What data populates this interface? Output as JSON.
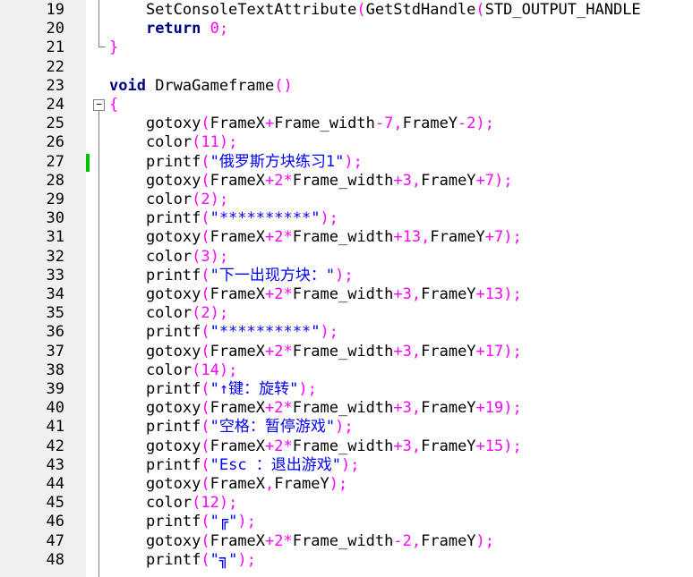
{
  "editor": {
    "colors": {
      "keyword": "#00008b",
      "number": "#ff00ff",
      "string": "#0000ff",
      "gutter": "#f0f0f0",
      "change_marker": "#00c000"
    },
    "lines": [
      {
        "n": "19",
        "tokens": [
          [
            "    SetConsoleTextAttribute",
            "t"
          ],
          [
            "(",
            "o"
          ],
          [
            "GetStdHandle",
            "t"
          ],
          [
            "(",
            "o"
          ],
          [
            "STD_OUTPUT_HANDLE",
            "t"
          ]
        ]
      },
      {
        "n": "20",
        "tokens": [
          [
            "    ",
            "t"
          ],
          [
            "return",
            "k"
          ],
          [
            " ",
            "t"
          ],
          [
            "0",
            "n"
          ],
          [
            ";",
            "o"
          ]
        ]
      },
      {
        "n": "21",
        "tokens": [
          [
            "}",
            "o"
          ]
        ]
      },
      {
        "n": "22",
        "tokens": []
      },
      {
        "n": "23",
        "tokens": [
          [
            "void",
            "k"
          ],
          [
            " DrwaGameframe",
            "t"
          ],
          [
            "()",
            "o"
          ]
        ]
      },
      {
        "n": "24",
        "tokens": [
          [
            "{",
            "o"
          ]
        ]
      },
      {
        "n": "25",
        "tokens": [
          [
            "    gotoxy",
            "t"
          ],
          [
            "(",
            "o"
          ],
          [
            "FrameX",
            "t"
          ],
          [
            "+",
            "o"
          ],
          [
            "Frame_width",
            "t"
          ],
          [
            "-",
            "o"
          ],
          [
            "7",
            "n"
          ],
          [
            ",",
            "o"
          ],
          [
            "FrameY",
            "t"
          ],
          [
            "-",
            "o"
          ],
          [
            "2",
            "n"
          ],
          [
            ");",
            "o"
          ]
        ]
      },
      {
        "n": "26",
        "tokens": [
          [
            "    color",
            "t"
          ],
          [
            "(",
            "o"
          ],
          [
            "11",
            "n"
          ],
          [
            ");",
            "o"
          ]
        ]
      },
      {
        "n": "27",
        "tokens": [
          [
            "    printf",
            "t"
          ],
          [
            "(",
            "o"
          ],
          [
            "\"俄罗斯方块练习1\"",
            "s"
          ],
          [
            ");",
            "o"
          ]
        ]
      },
      {
        "n": "28",
        "tokens": [
          [
            "    gotoxy",
            "t"
          ],
          [
            "(",
            "o"
          ],
          [
            "FrameX",
            "t"
          ],
          [
            "+",
            "o"
          ],
          [
            "2",
            "n"
          ],
          [
            "*",
            "o"
          ],
          [
            "Frame_width",
            "t"
          ],
          [
            "+",
            "o"
          ],
          [
            "3",
            "n"
          ],
          [
            ",",
            "o"
          ],
          [
            "FrameY",
            "t"
          ],
          [
            "+",
            "o"
          ],
          [
            "7",
            "n"
          ],
          [
            ");",
            "o"
          ]
        ]
      },
      {
        "n": "29",
        "tokens": [
          [
            "    color",
            "t"
          ],
          [
            "(",
            "o"
          ],
          [
            "2",
            "n"
          ],
          [
            ");",
            "o"
          ]
        ]
      },
      {
        "n": "30",
        "tokens": [
          [
            "    printf",
            "t"
          ],
          [
            "(",
            "o"
          ],
          [
            "\"**********\"",
            "s"
          ],
          [
            ");",
            "o"
          ]
        ]
      },
      {
        "n": "31",
        "tokens": [
          [
            "    gotoxy",
            "t"
          ],
          [
            "(",
            "o"
          ],
          [
            "FrameX",
            "t"
          ],
          [
            "+",
            "o"
          ],
          [
            "2",
            "n"
          ],
          [
            "*",
            "o"
          ],
          [
            "Frame_width",
            "t"
          ],
          [
            "+",
            "o"
          ],
          [
            "13",
            "n"
          ],
          [
            ",",
            "o"
          ],
          [
            "FrameY",
            "t"
          ],
          [
            "+",
            "o"
          ],
          [
            "7",
            "n"
          ],
          [
            ");",
            "o"
          ]
        ]
      },
      {
        "n": "32",
        "tokens": [
          [
            "    color",
            "t"
          ],
          [
            "(",
            "o"
          ],
          [
            "3",
            "n"
          ],
          [
            ");",
            "o"
          ]
        ]
      },
      {
        "n": "33",
        "tokens": [
          [
            "    printf",
            "t"
          ],
          [
            "(",
            "o"
          ],
          [
            "\"下一出现方块：\"",
            "s"
          ],
          [
            ");",
            "o"
          ]
        ]
      },
      {
        "n": "34",
        "tokens": [
          [
            "    gotoxy",
            "t"
          ],
          [
            "(",
            "o"
          ],
          [
            "FrameX",
            "t"
          ],
          [
            "+",
            "o"
          ],
          [
            "2",
            "n"
          ],
          [
            "*",
            "o"
          ],
          [
            "Frame_width",
            "t"
          ],
          [
            "+",
            "o"
          ],
          [
            "3",
            "n"
          ],
          [
            ",",
            "o"
          ],
          [
            "FrameY",
            "t"
          ],
          [
            "+",
            "o"
          ],
          [
            "13",
            "n"
          ],
          [
            ");",
            "o"
          ]
        ]
      },
      {
        "n": "35",
        "tokens": [
          [
            "    color",
            "t"
          ],
          [
            "(",
            "o"
          ],
          [
            "2",
            "n"
          ],
          [
            ");",
            "o"
          ]
        ]
      },
      {
        "n": "36",
        "tokens": [
          [
            "    printf",
            "t"
          ],
          [
            "(",
            "o"
          ],
          [
            "\"**********\"",
            "s"
          ],
          [
            ");",
            "o"
          ]
        ]
      },
      {
        "n": "37",
        "tokens": [
          [
            "    gotoxy",
            "t"
          ],
          [
            "(",
            "o"
          ],
          [
            "FrameX",
            "t"
          ],
          [
            "+",
            "o"
          ],
          [
            "2",
            "n"
          ],
          [
            "*",
            "o"
          ],
          [
            "Frame_width",
            "t"
          ],
          [
            "+",
            "o"
          ],
          [
            "3",
            "n"
          ],
          [
            ",",
            "o"
          ],
          [
            "FrameY",
            "t"
          ],
          [
            "+",
            "o"
          ],
          [
            "17",
            "n"
          ],
          [
            ");",
            "o"
          ]
        ]
      },
      {
        "n": "38",
        "tokens": [
          [
            "    color",
            "t"
          ],
          [
            "(",
            "o"
          ],
          [
            "14",
            "n"
          ],
          [
            ");",
            "o"
          ]
        ]
      },
      {
        "n": "39",
        "tokens": [
          [
            "    printf",
            "t"
          ],
          [
            "(",
            "o"
          ],
          [
            "\"↑键：旋转\"",
            "s"
          ],
          [
            ");",
            "o"
          ]
        ]
      },
      {
        "n": "40",
        "tokens": [
          [
            "    gotoxy",
            "t"
          ],
          [
            "(",
            "o"
          ],
          [
            "FrameX",
            "t"
          ],
          [
            "+",
            "o"
          ],
          [
            "2",
            "n"
          ],
          [
            "*",
            "o"
          ],
          [
            "Frame_width",
            "t"
          ],
          [
            "+",
            "o"
          ],
          [
            "3",
            "n"
          ],
          [
            ",",
            "o"
          ],
          [
            "FrameY",
            "t"
          ],
          [
            "+",
            "o"
          ],
          [
            "19",
            "n"
          ],
          [
            ");",
            "o"
          ]
        ]
      },
      {
        "n": "41",
        "tokens": [
          [
            "    printf",
            "t"
          ],
          [
            "(",
            "o"
          ],
          [
            "\"空格：暂停游戏\"",
            "s"
          ],
          [
            ");",
            "o"
          ]
        ]
      },
      {
        "n": "42",
        "tokens": [
          [
            "    gotoxy",
            "t"
          ],
          [
            "(",
            "o"
          ],
          [
            "FrameX",
            "t"
          ],
          [
            "+",
            "o"
          ],
          [
            "2",
            "n"
          ],
          [
            "*",
            "o"
          ],
          [
            "Frame_width",
            "t"
          ],
          [
            "+",
            "o"
          ],
          [
            "3",
            "n"
          ],
          [
            ",",
            "o"
          ],
          [
            "FrameY",
            "t"
          ],
          [
            "+",
            "o"
          ],
          [
            "15",
            "n"
          ],
          [
            ");",
            "o"
          ]
        ]
      },
      {
        "n": "43",
        "tokens": [
          [
            "    printf",
            "t"
          ],
          [
            "(",
            "o"
          ],
          [
            "\"Esc ：退出游戏\"",
            "s"
          ],
          [
            ");",
            "o"
          ]
        ]
      },
      {
        "n": "44",
        "tokens": [
          [
            "    gotoxy",
            "t"
          ],
          [
            "(",
            "o"
          ],
          [
            "FrameX",
            "t"
          ],
          [
            ",",
            "o"
          ],
          [
            "FrameY",
            "t"
          ],
          [
            ");",
            "o"
          ]
        ]
      },
      {
        "n": "45",
        "tokens": [
          [
            "    color",
            "t"
          ],
          [
            "(",
            "o"
          ],
          [
            "12",
            "n"
          ],
          [
            ");",
            "o"
          ]
        ]
      },
      {
        "n": "46",
        "tokens": [
          [
            "    printf",
            "t"
          ],
          [
            "(",
            "o"
          ],
          [
            "\"╔\"",
            "s"
          ],
          [
            ");",
            "o"
          ]
        ]
      },
      {
        "n": "47",
        "tokens": [
          [
            "    gotoxy",
            "t"
          ],
          [
            "(",
            "o"
          ],
          [
            "FrameX",
            "t"
          ],
          [
            "+",
            "o"
          ],
          [
            "2",
            "n"
          ],
          [
            "*",
            "o"
          ],
          [
            "Frame_width",
            "t"
          ],
          [
            "-",
            "o"
          ],
          [
            "2",
            "n"
          ],
          [
            ",",
            "o"
          ],
          [
            "FrameY",
            "t"
          ],
          [
            ");",
            "o"
          ]
        ]
      },
      {
        "n": "48",
        "tokens": [
          [
            "    printf",
            "t"
          ],
          [
            "(",
            "o"
          ],
          [
            "\"╗\"",
            "s"
          ],
          [
            ");",
            "o"
          ]
        ]
      }
    ]
  }
}
